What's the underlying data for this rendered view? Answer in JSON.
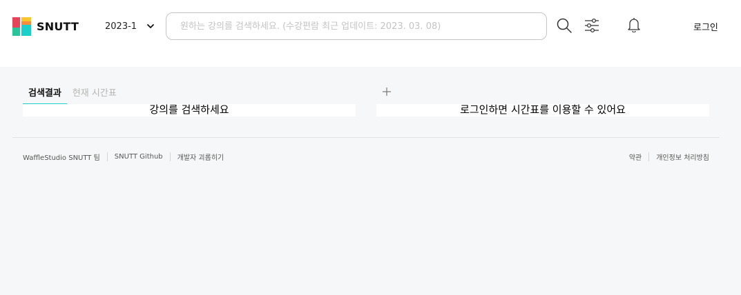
{
  "header": {
    "logo_text": "SNUTT",
    "logo_colors": [
      "#e54459",
      "#f58d3d",
      "#fac52d",
      "#a6d930",
      "#2bc399",
      "#1bd0c8"
    ],
    "semester": "2023-1",
    "search_placeholder": "원하는 강의를 검색하세요. (수강편람 최근 업데이트: 2023. 03. 08)",
    "search_icon": "magnifier-icon",
    "filter_icon": "sliders-icon",
    "notification_icon": "bell-icon",
    "login_label": "로그인"
  },
  "tabs": [
    {
      "label": "검색결과",
      "active": true
    },
    {
      "label": "현재 시간표",
      "active": false
    }
  ],
  "add_icon": "plus-icon",
  "search_panel_message": "강의를 검색하세요",
  "timetable_panel_message": "로그인하면 시간표를 이용할 수 있어요",
  "footer": {
    "left_links": [
      "WaffleStudio SNUTT 팀",
      "SNUTT Github",
      "개발자 괴롭히기"
    ],
    "right_links": [
      "약관",
      "개인정보 처리방침"
    ]
  },
  "colors": {
    "accent": "#1bd0c8",
    "background": "#f6f7f8",
    "border": "#c4c4c4"
  }
}
